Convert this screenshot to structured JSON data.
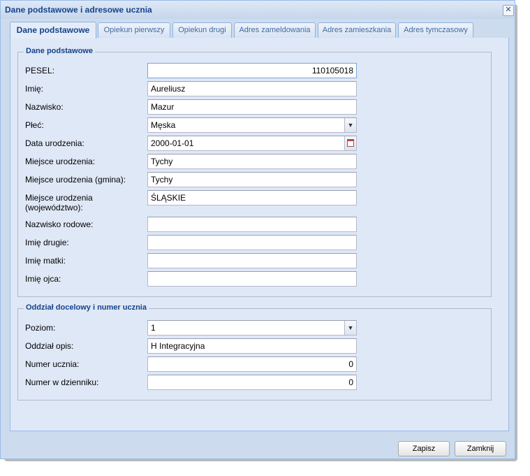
{
  "window": {
    "title": "Dane podstawowe i adresowe ucznia",
    "close_symbol": "✕"
  },
  "tabs": [
    {
      "label": "Dane podstawowe",
      "active": true
    },
    {
      "label": "Opiekun pierwszy",
      "active": false
    },
    {
      "label": "Opiekun drugi",
      "active": false
    },
    {
      "label": "Adres zameldowania",
      "active": false
    },
    {
      "label": "Adres zamieszkania",
      "active": false
    },
    {
      "label": "Adres tymczasowy",
      "active": false
    }
  ],
  "basic": {
    "legend": "Dane podstawowe",
    "fields": [
      {
        "label": "PESEL:",
        "value": "110105018"
      },
      {
        "label": "Imię:",
        "value": "Aureliusz"
      },
      {
        "label": "Nazwisko:",
        "value": "Mazur"
      },
      {
        "label": "Płeć:",
        "value": "Męska"
      },
      {
        "label": "Data urodzenia:",
        "value": "2000-01-01"
      },
      {
        "label": "Miejsce urodzenia:",
        "value": "Tychy"
      },
      {
        "label": "Miejsce urodzenia (gmina):",
        "value": "Tychy"
      },
      {
        "label": "Miejsce urodzenia",
        "label2": "(województwo):",
        "value": "ŚLĄSKIE"
      },
      {
        "label": "Nazwisko rodowe:",
        "value": ""
      },
      {
        "label": "Imię drugie:",
        "value": ""
      },
      {
        "label": "Imię matki:",
        "value": ""
      },
      {
        "label": "Imię ojca:",
        "value": ""
      }
    ]
  },
  "class_section": {
    "legend": "Oddział docelowy i numer ucznia",
    "fields": [
      {
        "label": "Poziom:",
        "value": "1"
      },
      {
        "label": "Oddział opis:",
        "value": "H Integracyjna"
      },
      {
        "label": "Numer ucznia:",
        "value": "0"
      },
      {
        "label": "Numer w dzienniku:",
        "value": "0"
      }
    ]
  },
  "buttons": {
    "save": "Zapisz",
    "close": "Zamknij"
  },
  "icons": {
    "dropdown": "chevron-down-icon",
    "calendar": "calendar-icon",
    "close": "close-icon"
  }
}
